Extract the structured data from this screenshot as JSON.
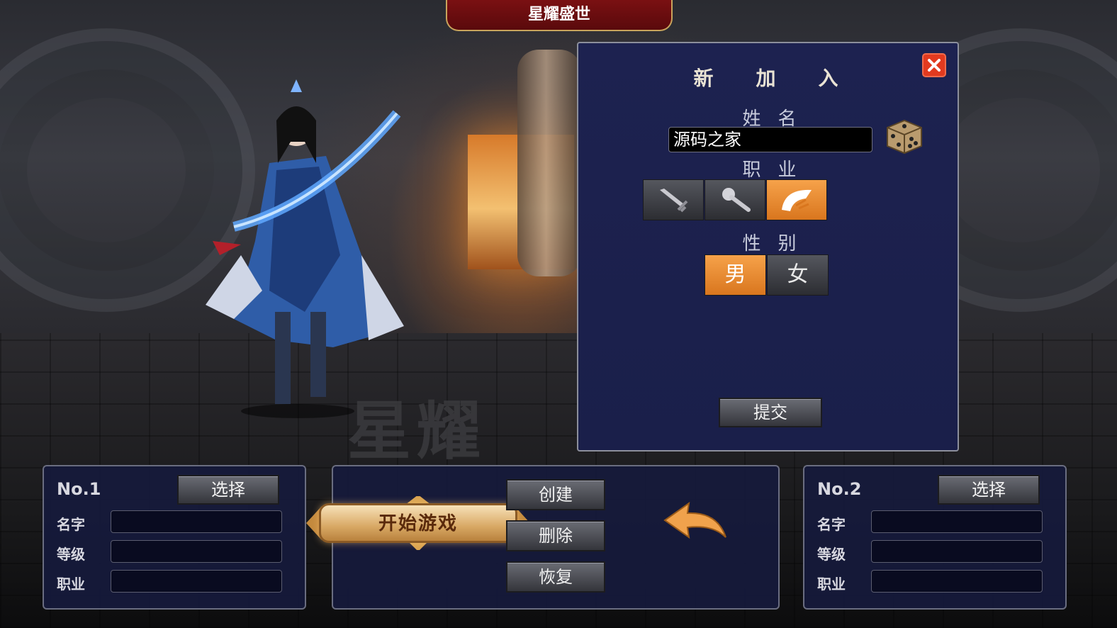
{
  "server_title": "星耀盛世",
  "watermark": "星耀",
  "create_panel": {
    "title": "新加入",
    "name_label": "姓名",
    "name_value": "源码之家",
    "class_label": "职业",
    "classes": [
      {
        "icon": "sword-icon",
        "selected": false
      },
      {
        "icon": "staff-icon",
        "selected": false
      },
      {
        "icon": "fan-icon",
        "selected": true
      }
    ],
    "gender_label": "性别",
    "genders": [
      {
        "label": "男",
        "selected": true
      },
      {
        "label": "女",
        "selected": false
      }
    ],
    "submit_label": "提交",
    "close_icon": "close-icon",
    "dice_icon": "dice-icon"
  },
  "slots": [
    {
      "number": "No.1",
      "select_label": "选择",
      "name_label": "名字",
      "level_label": "等级",
      "class_label": "职业"
    },
    {
      "number": "No.2",
      "select_label": "选择",
      "name_label": "名字",
      "level_label": "等级",
      "class_label": "职业"
    }
  ],
  "actions": {
    "start_label": "开始游戏",
    "create_label": "创建",
    "delete_label": "删除",
    "restore_label": "恢复",
    "back_icon": "back-arrow-icon"
  },
  "colors": {
    "panel_bg": "#1d2250",
    "accent_orange": "#f6a24a",
    "close_red": "#e23a1f",
    "title_red": "#7a1012"
  }
}
